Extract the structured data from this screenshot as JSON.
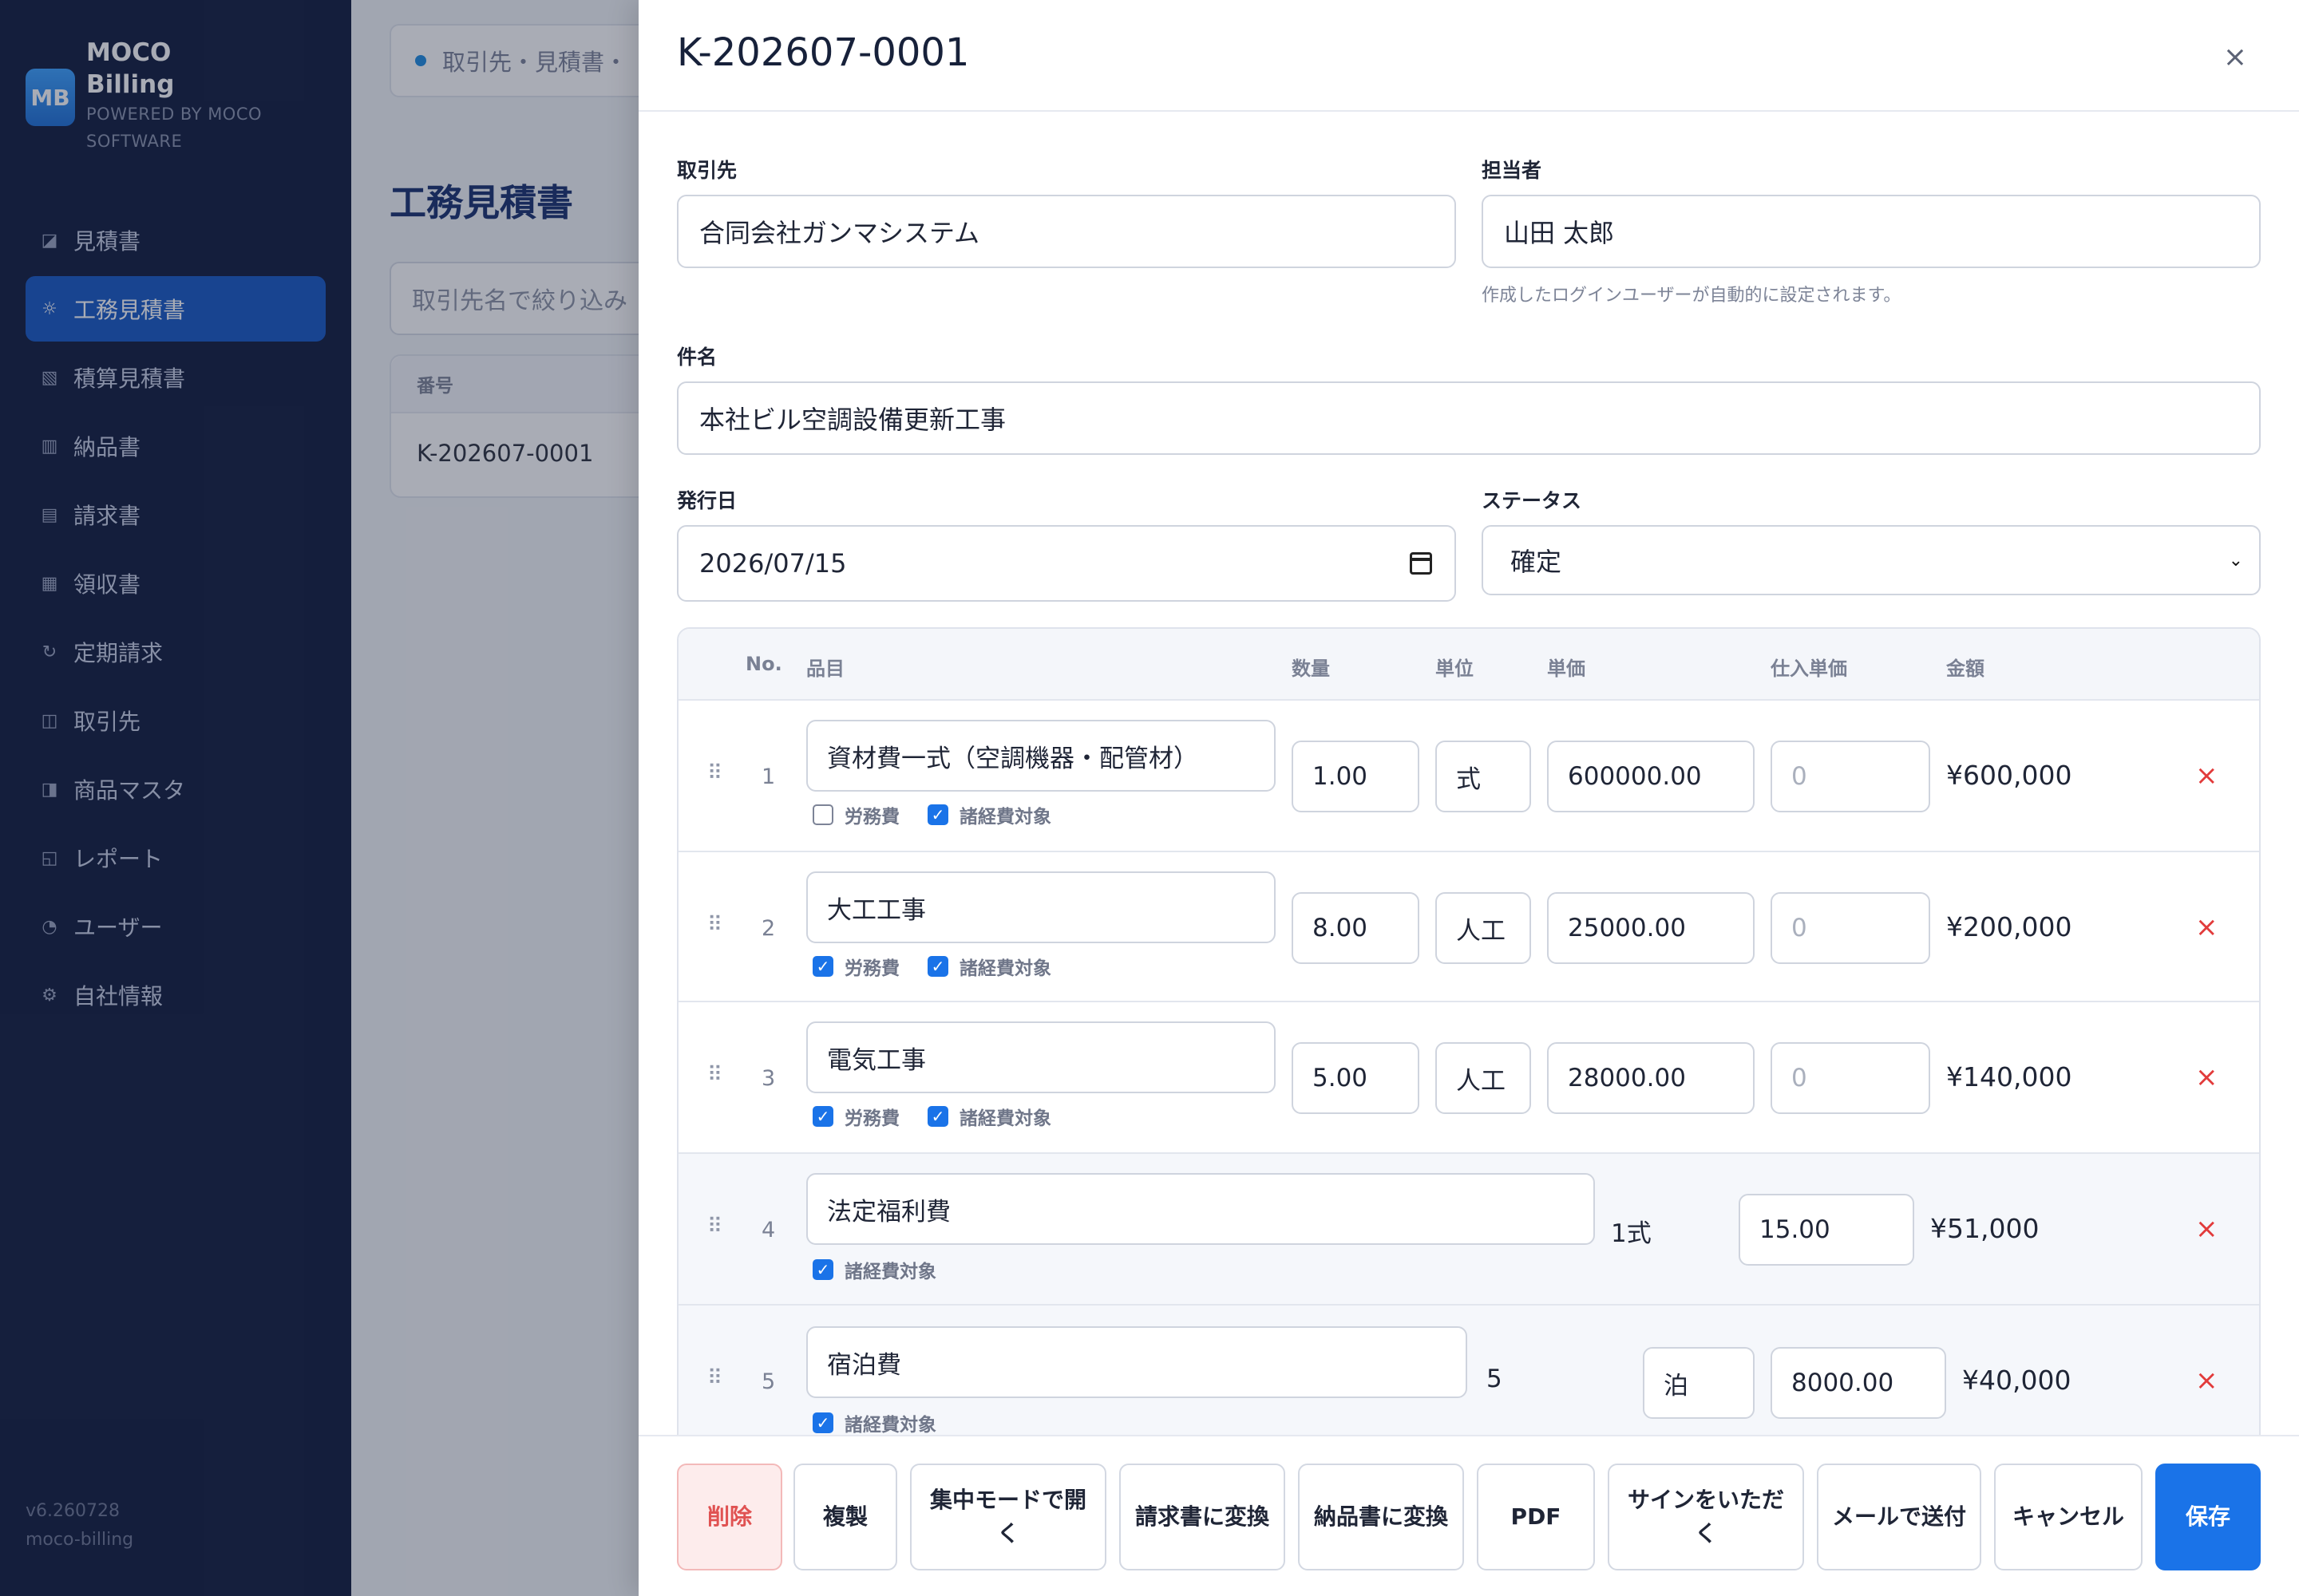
{
  "brand": {
    "logo": "MB",
    "name": "MOCO Billing",
    "sub": "POWERED BY MOCO SOFTWARE"
  },
  "sidebar": {
    "items": [
      {
        "label": "見積書",
        "icon": "◪"
      },
      {
        "label": "工務見積書",
        "icon": "☼"
      },
      {
        "label": "積算見積書",
        "icon": "▧"
      },
      {
        "label": "納品書",
        "icon": "▥"
      },
      {
        "label": "請求書",
        "icon": "▤"
      },
      {
        "label": "領収書",
        "icon": "▦"
      },
      {
        "label": "定期請求",
        "icon": "↻"
      },
      {
        "label": "取引先",
        "icon": "◫"
      },
      {
        "label": "商品マスタ",
        "icon": "◨"
      },
      {
        "label": "レポート",
        "icon": "◱"
      },
      {
        "label": "ユーザー",
        "icon": "◔"
      },
      {
        "label": "自社情報",
        "icon": "⚙"
      }
    ],
    "active_index": 1,
    "version": "v6.260728",
    "app_id": "moco-billing"
  },
  "background": {
    "breadcrumb": "取引先・見積書・",
    "page_title": "工務見積書",
    "filter_placeholder": "取引先名で絞り込み",
    "list_header": "番号",
    "list_row": "K-202607-0001"
  },
  "drawer": {
    "title": "K-202607-0001",
    "close": "×",
    "customer_label": "取引先",
    "customer_value": "合同会社ガンマシステム",
    "owner_label": "担当者",
    "owner_value": "山田 太郎",
    "owner_hint": "作成したログインユーザーが自動的に設定されます。",
    "subject_label": "件名",
    "subject_value": "本社ビル空調設備更新工事",
    "date_label": "発行日",
    "date_value": "2026/07/15",
    "status_label": "ステータス",
    "status_value": "確定"
  },
  "items": {
    "headers": {
      "no": "No.",
      "item": "品目",
      "qty": "数量",
      "unit": "単位",
      "price": "単価",
      "cost": "仕入単価",
      "amount": "金額"
    },
    "labor_label": "労務費",
    "overhead_label": "諸経費対象",
    "rows": [
      {
        "no": "1",
        "name": "資材費一式（空調機器・配管材）",
        "qty": "1.00",
        "unit": "式",
        "price": "600000.00",
        "cost": "0",
        "amount": "¥600,000",
        "labor": false,
        "overhead": true
      },
      {
        "no": "2",
        "name": "大工工事",
        "qty": "8.00",
        "unit": "人工",
        "price": "25000.00",
        "cost": "0",
        "amount": "¥200,000",
        "labor": true,
        "overhead": true
      },
      {
        "no": "3",
        "name": "電気工事",
        "qty": "5.00",
        "unit": "人工",
        "price": "28000.00",
        "cost": "0",
        "amount": "¥140,000",
        "labor": true,
        "overhead": true
      },
      {
        "no": "4",
        "name": "法定福利費",
        "qty_text": "1式",
        "rate": "15.00",
        "amount": "¥51,000",
        "overhead": true
      },
      {
        "no": "5",
        "name": "宿泊費",
        "qty_text": "5",
        "unit": "泊",
        "price": "8000.00",
        "amount": "¥40,000",
        "overhead": true
      }
    ],
    "delete_icon": "×"
  },
  "footer": {
    "delete": "削除",
    "duplicate": "複製",
    "focus": "集中モードで開く",
    "to_invoice": "請求書に変換",
    "to_delivery": "納品書に変換",
    "pdf": "PDF",
    "sign": "サインをいただく",
    "mail": "メールで送付",
    "cancel": "キャンセル",
    "save": "保存"
  }
}
